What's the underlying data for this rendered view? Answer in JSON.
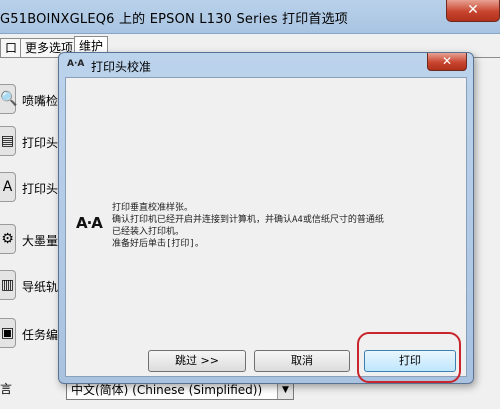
{
  "main_window": {
    "title": "G51BOINXGLEQ6 上的 EPSON L130 Series 打印首选项",
    "close_glyph": "✕"
  },
  "tabs": [
    {
      "label": "口"
    },
    {
      "label": "更多选项"
    },
    {
      "label": "维护"
    }
  ],
  "sidebar": {
    "items": [
      {
        "label": "喷嘴检查",
        "icon": "magnifier-icon",
        "glyph": "🔍"
      },
      {
        "label": "打印头清",
        "icon": "printhead-clean-icon",
        "glyph": "▤"
      },
      {
        "label": "打印头校",
        "icon": "printhead-align-icon",
        "glyph": "A"
      },
      {
        "label": "大墨量清",
        "icon": "ink-flush-icon",
        "glyph": "⚙"
      },
      {
        "label": "导纸轨清",
        "icon": "paper-guide-icon",
        "glyph": "▥"
      },
      {
        "label": "任务编辑",
        "icon": "job-arranger-icon",
        "glyph": "▣"
      }
    ]
  },
  "language": {
    "label": "言",
    "selected": "中文(简体) (Chinese (Simplified))"
  },
  "dialog": {
    "title": "打印头校准",
    "title_icon": "A·A",
    "close_glyph": "✕",
    "big_icon": "A·A",
    "message_lines": [
      "打印垂直校准样张。",
      "确认打印机已经开启并连接到计算机，并确认A4或信纸尺寸的普通纸",
      "已经装入打印机。",
      "准备好后单击[打印]。"
    ],
    "buttons": {
      "skip": "跳过 >>",
      "cancel": "取消",
      "print": "打印"
    }
  },
  "colors": {
    "highlight": "#c8262b",
    "title_bar": "#b9d1ea"
  }
}
